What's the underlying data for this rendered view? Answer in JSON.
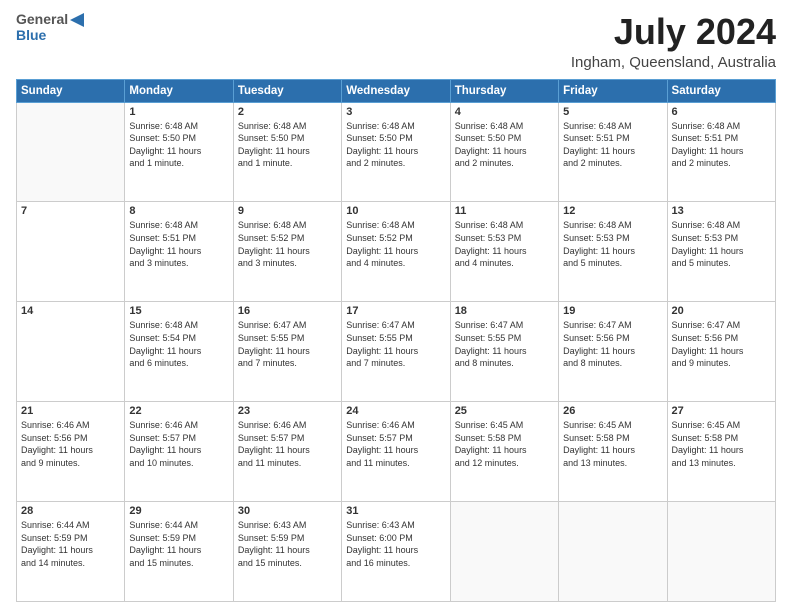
{
  "logo": {
    "general": "General",
    "blue": "Blue"
  },
  "header": {
    "month": "July 2024",
    "location": "Ingham, Queensland, Australia"
  },
  "days_of_week": [
    "Sunday",
    "Monday",
    "Tuesday",
    "Wednesday",
    "Thursday",
    "Friday",
    "Saturday"
  ],
  "weeks": [
    [
      {
        "day": "",
        "info": ""
      },
      {
        "day": "1",
        "info": "Sunrise: 6:48 AM\nSunset: 5:50 PM\nDaylight: 11 hours\nand 1 minute."
      },
      {
        "day": "2",
        "info": "Sunrise: 6:48 AM\nSunset: 5:50 PM\nDaylight: 11 hours\nand 1 minute."
      },
      {
        "day": "3",
        "info": "Sunrise: 6:48 AM\nSunset: 5:50 PM\nDaylight: 11 hours\nand 2 minutes."
      },
      {
        "day": "4",
        "info": "Sunrise: 6:48 AM\nSunset: 5:50 PM\nDaylight: 11 hours\nand 2 minutes."
      },
      {
        "day": "5",
        "info": "Sunrise: 6:48 AM\nSunset: 5:51 PM\nDaylight: 11 hours\nand 2 minutes."
      },
      {
        "day": "6",
        "info": "Sunrise: 6:48 AM\nSunset: 5:51 PM\nDaylight: 11 hours\nand 2 minutes."
      }
    ],
    [
      {
        "day": "7",
        "info": ""
      },
      {
        "day": "8",
        "info": "Sunrise: 6:48 AM\nSunset: 5:51 PM\nDaylight: 11 hours\nand 3 minutes."
      },
      {
        "day": "9",
        "info": "Sunrise: 6:48 AM\nSunset: 5:52 PM\nDaylight: 11 hours\nand 3 minutes."
      },
      {
        "day": "10",
        "info": "Sunrise: 6:48 AM\nSunset: 5:52 PM\nDaylight: 11 hours\nand 4 minutes."
      },
      {
        "day": "11",
        "info": "Sunrise: 6:48 AM\nSunset: 5:53 PM\nDaylight: 11 hours\nand 4 minutes."
      },
      {
        "day": "12",
        "info": "Sunrise: 6:48 AM\nSunset: 5:53 PM\nDaylight: 11 hours\nand 5 minutes."
      },
      {
        "day": "13",
        "info": "Sunrise: 6:48 AM\nSunset: 5:53 PM\nDaylight: 11 hours\nand 5 minutes."
      }
    ],
    [
      {
        "day": "14",
        "info": ""
      },
      {
        "day": "15",
        "info": "Sunrise: 6:48 AM\nSunset: 5:54 PM\nDaylight: 11 hours\nand 6 minutes."
      },
      {
        "day": "16",
        "info": "Sunrise: 6:47 AM\nSunset: 5:55 PM\nDaylight: 11 hours\nand 7 minutes."
      },
      {
        "day": "17",
        "info": "Sunrise: 6:47 AM\nSunset: 5:55 PM\nDaylight: 11 hours\nand 7 minutes."
      },
      {
        "day": "18",
        "info": "Sunrise: 6:47 AM\nSunset: 5:55 PM\nDaylight: 11 hours\nand 8 minutes."
      },
      {
        "day": "19",
        "info": "Sunrise: 6:47 AM\nSunset: 5:56 PM\nDaylight: 11 hours\nand 8 minutes."
      },
      {
        "day": "20",
        "info": "Sunrise: 6:47 AM\nSunset: 5:56 PM\nDaylight: 11 hours\nand 9 minutes."
      }
    ],
    [
      {
        "day": "21",
        "info": "Sunrise: 6:46 AM\nSunset: 5:56 PM\nDaylight: 11 hours\nand 9 minutes."
      },
      {
        "day": "22",
        "info": "Sunrise: 6:46 AM\nSunset: 5:57 PM\nDaylight: 11 hours\nand 10 minutes."
      },
      {
        "day": "23",
        "info": "Sunrise: 6:46 AM\nSunset: 5:57 PM\nDaylight: 11 hours\nand 11 minutes."
      },
      {
        "day": "24",
        "info": "Sunrise: 6:46 AM\nSunset: 5:57 PM\nDaylight: 11 hours\nand 11 minutes."
      },
      {
        "day": "25",
        "info": "Sunrise: 6:45 AM\nSunset: 5:58 PM\nDaylight: 11 hours\nand 12 minutes."
      },
      {
        "day": "26",
        "info": "Sunrise: 6:45 AM\nSunset: 5:58 PM\nDaylight: 11 hours\nand 13 minutes."
      },
      {
        "day": "27",
        "info": "Sunrise: 6:45 AM\nSunset: 5:58 PM\nDaylight: 11 hours\nand 13 minutes."
      }
    ],
    [
      {
        "day": "28",
        "info": "Sunrise: 6:44 AM\nSunset: 5:59 PM\nDaylight: 11 hours\nand 14 minutes."
      },
      {
        "day": "29",
        "info": "Sunrise: 6:44 AM\nSunset: 5:59 PM\nDaylight: 11 hours\nand 15 minutes."
      },
      {
        "day": "30",
        "info": "Sunrise: 6:43 AM\nSunset: 5:59 PM\nDaylight: 11 hours\nand 15 minutes."
      },
      {
        "day": "31",
        "info": "Sunrise: 6:43 AM\nSunset: 6:00 PM\nDaylight: 11 hours\nand 16 minutes."
      },
      {
        "day": "",
        "info": ""
      },
      {
        "day": "",
        "info": ""
      },
      {
        "day": "",
        "info": ""
      }
    ]
  ]
}
